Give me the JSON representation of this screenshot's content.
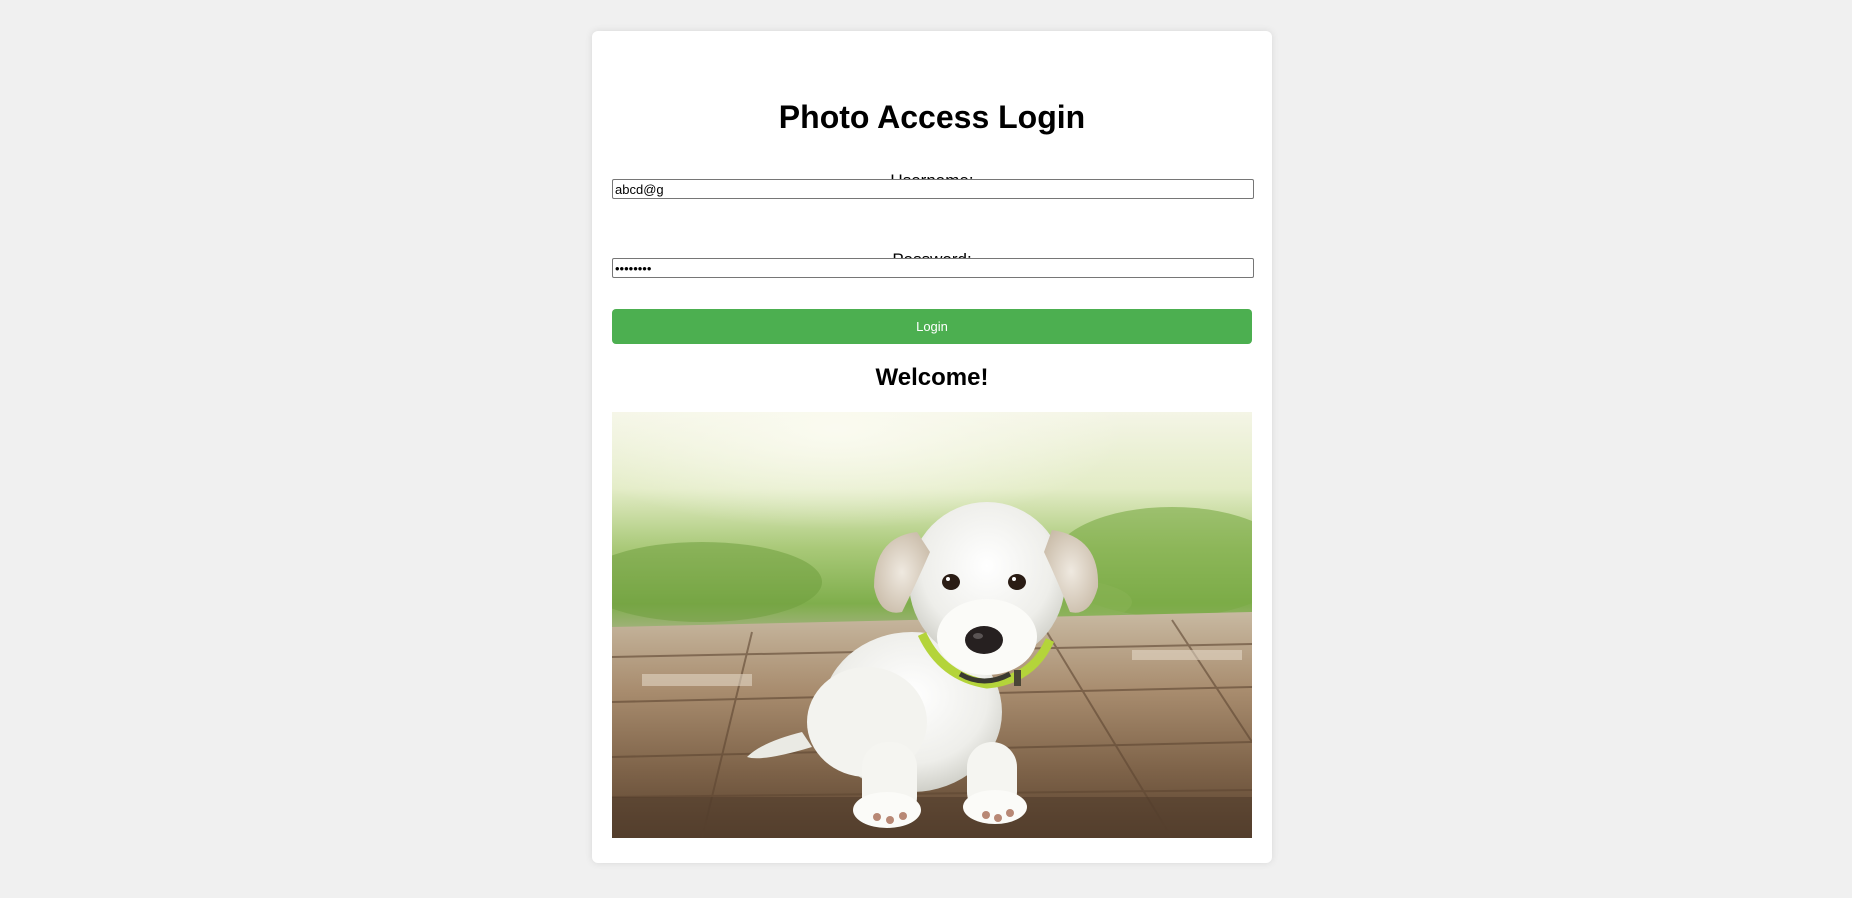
{
  "page": {
    "title": "Photo Access Login",
    "background_color": "#f0f0f0",
    "accent_color": "#4caf50"
  },
  "form": {
    "username_label": "Username:",
    "username_value": "abcd@g",
    "password_label": "Password:",
    "password_value": "12345678",
    "login_label": "Login"
  },
  "welcome": {
    "heading": "Welcome!",
    "image_alt": "white puppy lying on wooden deck"
  }
}
